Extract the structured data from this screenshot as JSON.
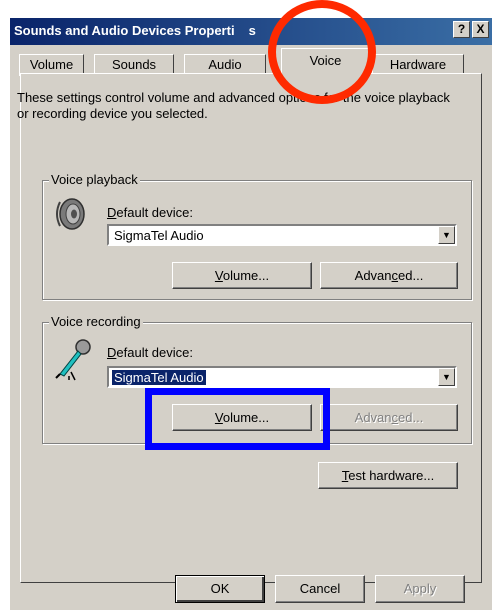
{
  "window": {
    "title": "Sounds and Audio Devices Properti",
    "title_suffix": "s",
    "help_button": "?",
    "close_button": "X"
  },
  "tabs": [
    {
      "label": "Volume"
    },
    {
      "label": "Sounds"
    },
    {
      "label": "Audio"
    },
    {
      "label": "Voice",
      "active": true
    },
    {
      "label": "Hardware"
    }
  ],
  "description": "These settings control volume and advanced options for the voice playback or recording device you selected.",
  "playback": {
    "group_label": "Voice playback",
    "device_label_prefix": "D",
    "device_label_rest": "efault device:",
    "device_value": "SigmaTel Audio",
    "volume_prefix": "V",
    "volume_rest": "olume...",
    "advanced_prefix": "Advan",
    "advanced_u": "c",
    "advanced_rest": "ed..."
  },
  "recording": {
    "group_label": "Voice recording",
    "device_label_prefix": "D",
    "device_label_rest": "efault device:",
    "device_value": "SigmaTel Audio",
    "volume_prefix": "V",
    "volume_rest": "olume...",
    "advanced_prefix": "Advan",
    "advanced_u": "c",
    "advanced_rest": "ed..."
  },
  "test_hardware": {
    "prefix": "T",
    "rest": "est hardware..."
  },
  "footer": {
    "ok": "OK",
    "cancel": "Cancel",
    "apply": "Apply"
  },
  "icons": {
    "speaker": "speaker-icon",
    "microphone": "microphone-icon",
    "dropdown_arrow": "▼"
  },
  "annotations": {
    "circle_color": "#ff2a00",
    "rect_color": "#0000ff"
  },
  "colors": {
    "dialog_face": "#d4d0c8",
    "titlebar": "#0a246a",
    "selection": "#0a246a"
  }
}
